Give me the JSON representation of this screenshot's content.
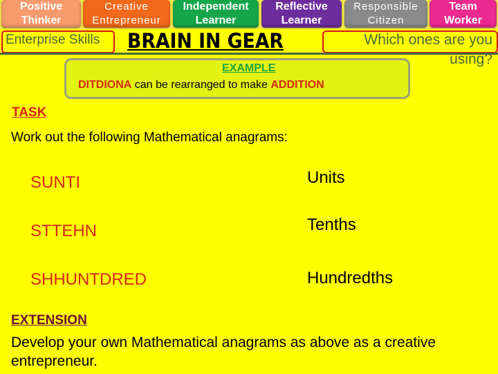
{
  "skills": [
    {
      "line1": "Positive",
      "line2": "Thinker",
      "color": "#f79a6c"
    },
    {
      "line1": "Creative",
      "line2": "Entrepreneur",
      "color": "#f2681b"
    },
    {
      "line1": "Independent",
      "line2": "Learner",
      "color": "#15a64a"
    },
    {
      "line1": "Reflective",
      "line2": "Learner",
      "color": "#6e2d9c"
    },
    {
      "line1": "Responsible",
      "line2": "Citizen",
      "color": "#8a8a8a"
    },
    {
      "line1": "Team",
      "line2": "Worker",
      "color": "#ec2a8f"
    }
  ],
  "header": {
    "enterprise_label": "Enterprise Skills",
    "title": "BRAIN IN GEAR",
    "question_line1": "Which ones are you",
    "question_line2": "using?"
  },
  "example": {
    "title": "EXAMPLE",
    "scrambled": "DITDIONA",
    "middle_text": " can be rearranged to make ",
    "answer": "ADDITION"
  },
  "task": {
    "title": "TASK",
    "instruction": "Work out the following Mathematical anagrams:",
    "items": [
      {
        "anagram": "SUNTI",
        "answer": "Units"
      },
      {
        "anagram": "STTEHN",
        "answer": "Tenths"
      },
      {
        "anagram": "SHHUNTDRED",
        "answer": "Hundredths"
      }
    ]
  },
  "extension": {
    "title": "EXTENSION",
    "text": "Develop your own Mathematical anagrams as above as a creative entrepreneur."
  }
}
